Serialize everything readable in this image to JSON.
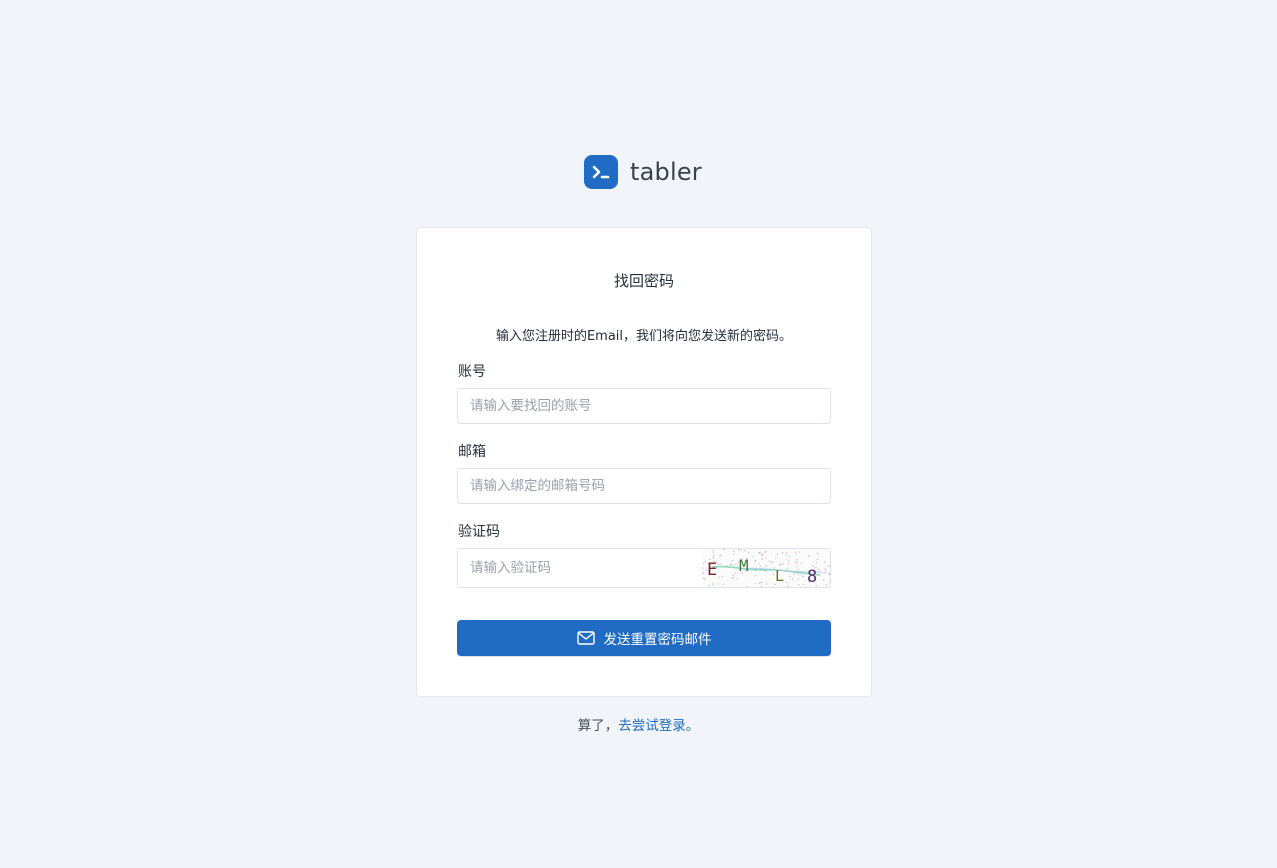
{
  "brand": {
    "name": "tabler",
    "logo_icon": "terminal-prompt-icon",
    "accent_color": "#206bc4"
  },
  "card": {
    "title": "找回密码",
    "description": "输入您注册时的Email，我们将向您发送新的密码。"
  },
  "form": {
    "account": {
      "label": "账号",
      "placeholder": "请输入要找回的账号",
      "value": ""
    },
    "email": {
      "label": "邮箱",
      "placeholder": "请输入绑定的邮箱号码",
      "value": ""
    },
    "captcha": {
      "label": "验证码",
      "placeholder": "请输入验证码",
      "value": "",
      "image_text": "EML8"
    },
    "submit": {
      "label": "发送重置密码邮件",
      "icon": "mail-icon"
    }
  },
  "footer": {
    "prefix": "算了，",
    "link_text": "去尝试登录。"
  }
}
